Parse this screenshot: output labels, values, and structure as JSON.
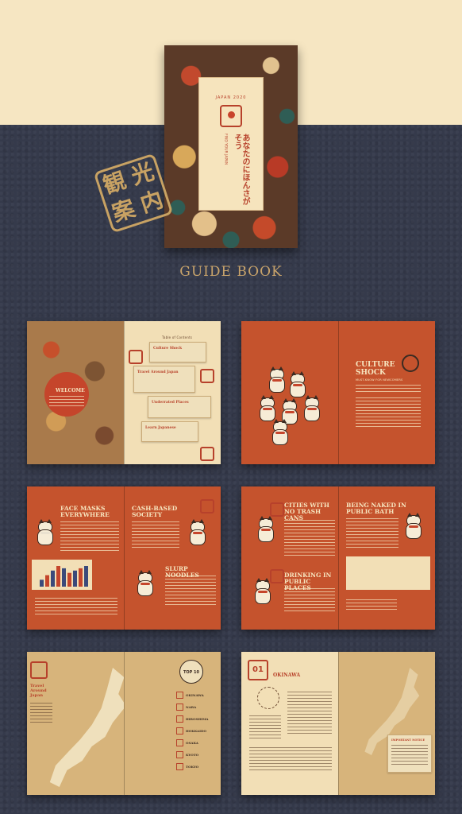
{
  "cover": {
    "year": "JAPAN 2020",
    "vertical_main": "あなたのにほんさがそう",
    "vertical_sub": "FIND YOUR JAPAN"
  },
  "stamp": {
    "chars": [
      "観",
      "光",
      "案",
      "内"
    ]
  },
  "section_title": "GUIDE BOOK",
  "spread1": {
    "welcome": "WELCOME",
    "toc_title": "Table of Contents",
    "toc_items": [
      "Culture Shock",
      "Travel Around Japan",
      "Underrated Places",
      "Learn Japanese"
    ]
  },
  "spread2": {
    "title": "CULTURE SHOCK",
    "sub": "MUST-KNOW FOR NEWCOMERS"
  },
  "spread3": {
    "h1": "FACE MASKS EVERYWHERE",
    "h2": "CASH-BASED SOCIETY",
    "h3": "SLURP NOODLES",
    "chart": {
      "type": "bar",
      "values": [
        3,
        5,
        7,
        9,
        8,
        6,
        7,
        8,
        9
      ]
    }
  },
  "spread4": {
    "h1": "CITIES WITH NO TRASH CANS",
    "h2": "BEING NAKED IN PUBLIC BATH",
    "h3": "DRINKING IN PUBLIC PLACES"
  },
  "spread5": {
    "title": "Travel Around Japan",
    "badge": "TOP 10",
    "cities": [
      "OKINAWA",
      "NARA",
      "HIROSHIMA",
      "HOKKAIDO",
      "OSAKA",
      "KYOTO",
      "TOKYO"
    ]
  },
  "spread6": {
    "number": "01",
    "title": "OKINAWA",
    "card_title": "IMPORTANT NOTICE"
  }
}
